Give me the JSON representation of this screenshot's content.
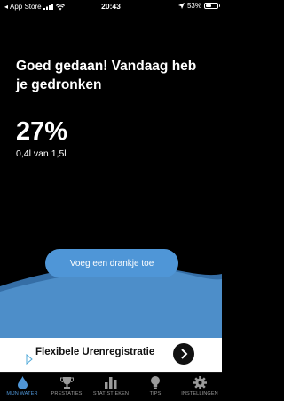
{
  "status_bar": {
    "back_label": "App Store",
    "time": "20:43",
    "battery_percent": "53%",
    "battery_level": 0.53
  },
  "main": {
    "headline": "Goed gedaan! Vandaag heb je gedronken",
    "percent": "27%",
    "amount": "0,4l van 1,5l",
    "add_drink_label": "Voeg een drankje toe",
    "colors": {
      "accent": "#4f96d7",
      "water_light": "#4d8ec9",
      "water_dark": "#356ea6"
    }
  },
  "ad": {
    "text": "Flexibele Urenregistratie"
  },
  "tabs": [
    {
      "label": "MIJN WATER",
      "icon": "water-drop-icon",
      "active": true
    },
    {
      "label": "PRESTATIES",
      "icon": "trophy-icon",
      "active": false
    },
    {
      "label": "STATISTIEKEN",
      "icon": "bar-chart-icon",
      "active": false
    },
    {
      "label": "TIPS",
      "icon": "lightbulb-icon",
      "active": false
    },
    {
      "label": "INSTELLINGEN",
      "icon": "gear-icon",
      "active": false
    }
  ]
}
